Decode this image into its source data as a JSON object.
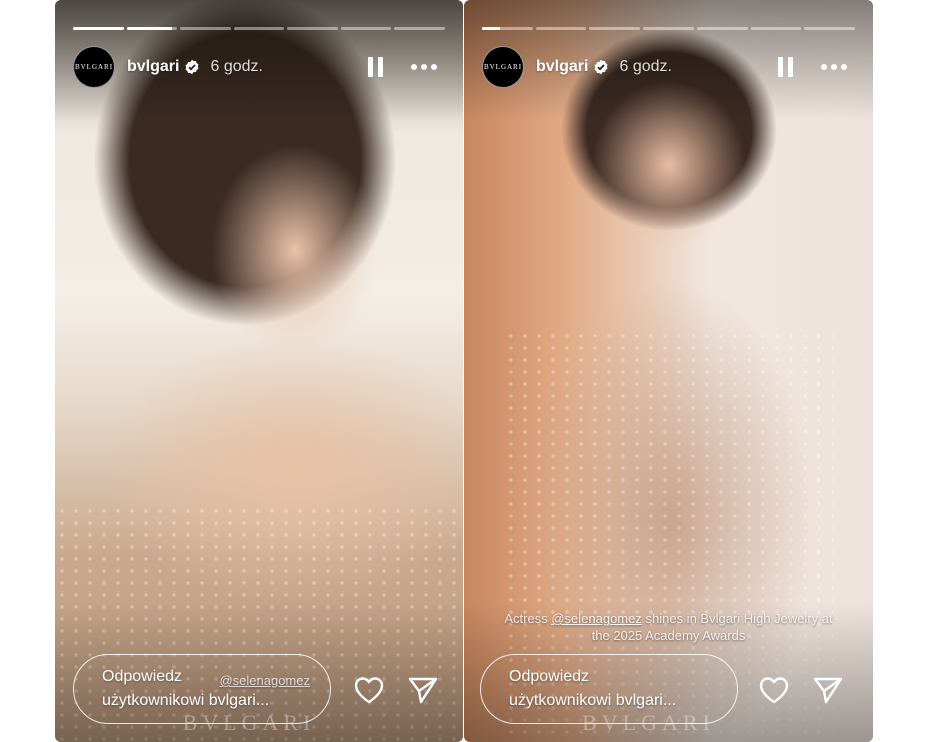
{
  "stories": [
    {
      "avatar_text": "BVLGARI",
      "username": "bvlgari",
      "time": "6 godz.",
      "progress": [
        1,
        0.9,
        0,
        0,
        0,
        0,
        0
      ],
      "reply_line1": "Odpowiedz",
      "reply_line2": "użytkownikowi bvlgari...",
      "reply_mention": "@selenagomez",
      "caption_mention": "",
      "caption_rest": "",
      "watermark": "BVLGARI"
    },
    {
      "avatar_text": "BVLGARI",
      "username": "bvlgari",
      "time": "6 godz.",
      "progress": [
        0.35,
        0,
        0,
        0,
        0,
        0,
        0
      ],
      "reply_line1": "Odpowiedz",
      "reply_line2": "użytkownikowi bvlgari...",
      "reply_mention": "",
      "caption_pre": "Actress ",
      "caption_mention": "@selenagomez",
      "caption_rest": " shines in Bvlgari High Jewelry at the 2025 Academy Awards",
      "watermark": "BVLGARI"
    }
  ],
  "icons": {
    "verified": "verified-badge-icon",
    "pause": "pause-icon",
    "more": "more-icon",
    "like": "heart-icon",
    "share": "send-icon"
  },
  "colors": {
    "verified": "#ffffff",
    "text": "#ffffff"
  }
}
